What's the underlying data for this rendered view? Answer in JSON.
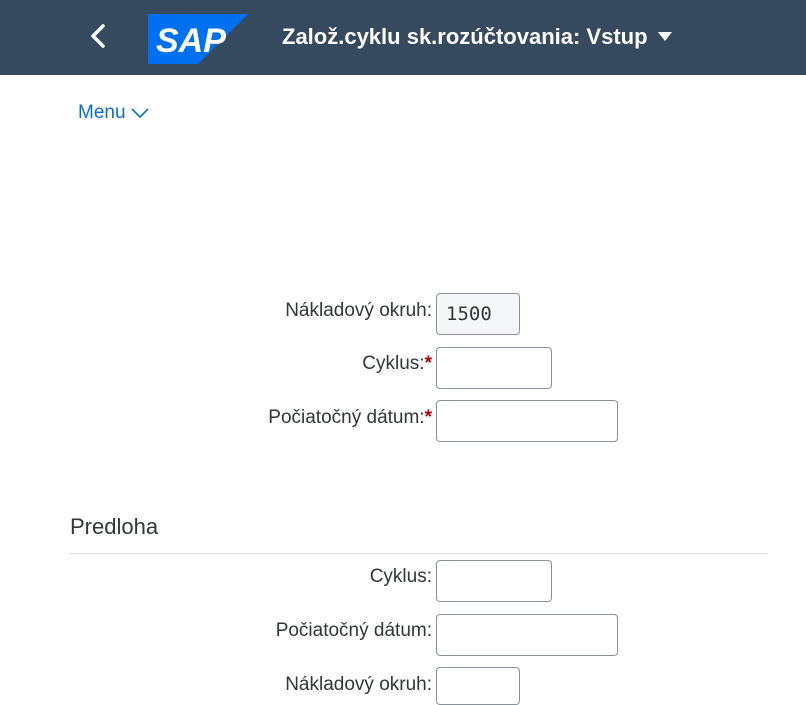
{
  "shell": {
    "title": "Založ.cyklu sk.rozúčtovania: Vstup",
    "logo_text": "SAP",
    "colors": {
      "shell_bg": "#354a5f",
      "logo_blue": "#0070f2",
      "link": "#0a6ed1",
      "required": "#bb0000"
    }
  },
  "menu": {
    "label": "Menu"
  },
  "main": {
    "fields": [
      {
        "label": "Nákladový okruh:",
        "value": "1500",
        "required": false,
        "readonly": true
      },
      {
        "label": "Cyklus:",
        "value": "",
        "required": true,
        "readonly": false
      },
      {
        "label": "Počiatočný dátum:",
        "value": "",
        "required": true,
        "readonly": false
      }
    ]
  },
  "template_section": {
    "title": "Predloha",
    "fields": [
      {
        "label": "Cyklus:",
        "value": ""
      },
      {
        "label": "Počiatočný dátum:",
        "value": ""
      },
      {
        "label": "Nákladový okruh:",
        "value": ""
      }
    ]
  },
  "icons": {
    "back": "chevron-left-icon",
    "title_dropdown": "caret-down-icon",
    "menu_dropdown": "chevron-down-icon",
    "required_marker": "asterisk"
  }
}
